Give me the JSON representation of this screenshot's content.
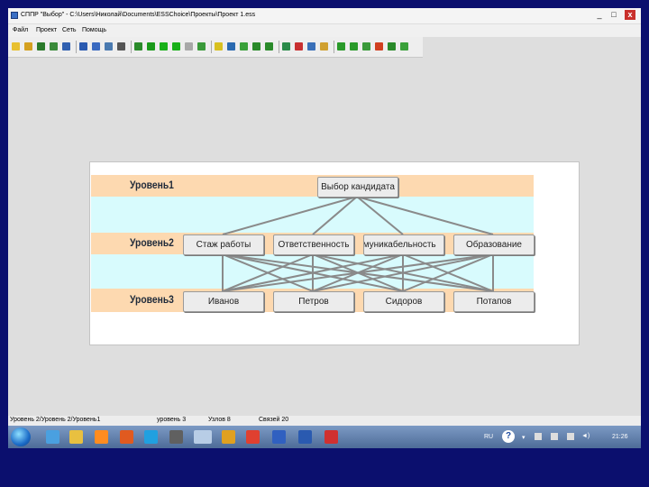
{
  "window": {
    "title": "СППР \"Выбор\" - C:\\Users\\Николай\\Documents\\ESSChoice\\Проекты\\Проект 1.ess",
    "minimize_symbol": "_",
    "maximize_symbol": "□",
    "close_symbol": "x"
  },
  "menu": [
    "Файл",
    "Проект",
    "Сеть",
    "Помощь"
  ],
  "toolbar": {
    "icons": [
      "new-icon",
      "open-icon",
      "save-icon",
      "save-as-icon",
      "print-icon",
      "copy-icon",
      "paste-icon",
      "table-icon",
      "properties-icon",
      "tree-icon",
      "run-icon",
      "play-icon",
      "play-icon",
      "settings-icon",
      "export-icon",
      "chart-icon",
      "search-icon",
      "network-icon",
      "node-icon",
      "node-icon",
      "refresh-icon",
      "image-icon",
      "zoom-icon",
      "flag-icon",
      "link-icon",
      "arrow-icon",
      "arrow-icon",
      "pointer-icon",
      "edit-icon",
      "up-icon"
    ]
  },
  "hierarchy": {
    "levels": [
      {
        "label": "Уровень1",
        "band_color": "#fdd9b0"
      },
      {
        "label": "Уровень2",
        "band_color": "#fdd9b0"
      },
      {
        "label": "Уровень3",
        "band_color": "#fdd9b0"
      }
    ],
    "gap_color": "#d8fbfd",
    "goal": "Выбор кандидата",
    "criteria": [
      "Стаж работы",
      "Ответственность",
      "Коммуникабельность",
      "Образование"
    ],
    "alternatives": [
      "Иванов",
      "Петров",
      "Сидоров",
      "Потапов"
    ]
  },
  "statusbar": {
    "left": "Уровень 2/Уровень 2/Уровень1",
    "mid1": "уровень 3",
    "mid2": "Узлов 8",
    "mid3": "Связей 20"
  },
  "taskbar": {
    "apps": [
      "ie-icon",
      "explorer-icon",
      "media-icon",
      "firefox-icon",
      "skype-icon",
      "app-icon",
      "choice-app-icon",
      "app2-icon",
      "pdf-icon",
      "save-icon",
      "word-icon",
      "acrobat-icon"
    ],
    "language": "RU",
    "clock": "21:26"
  }
}
